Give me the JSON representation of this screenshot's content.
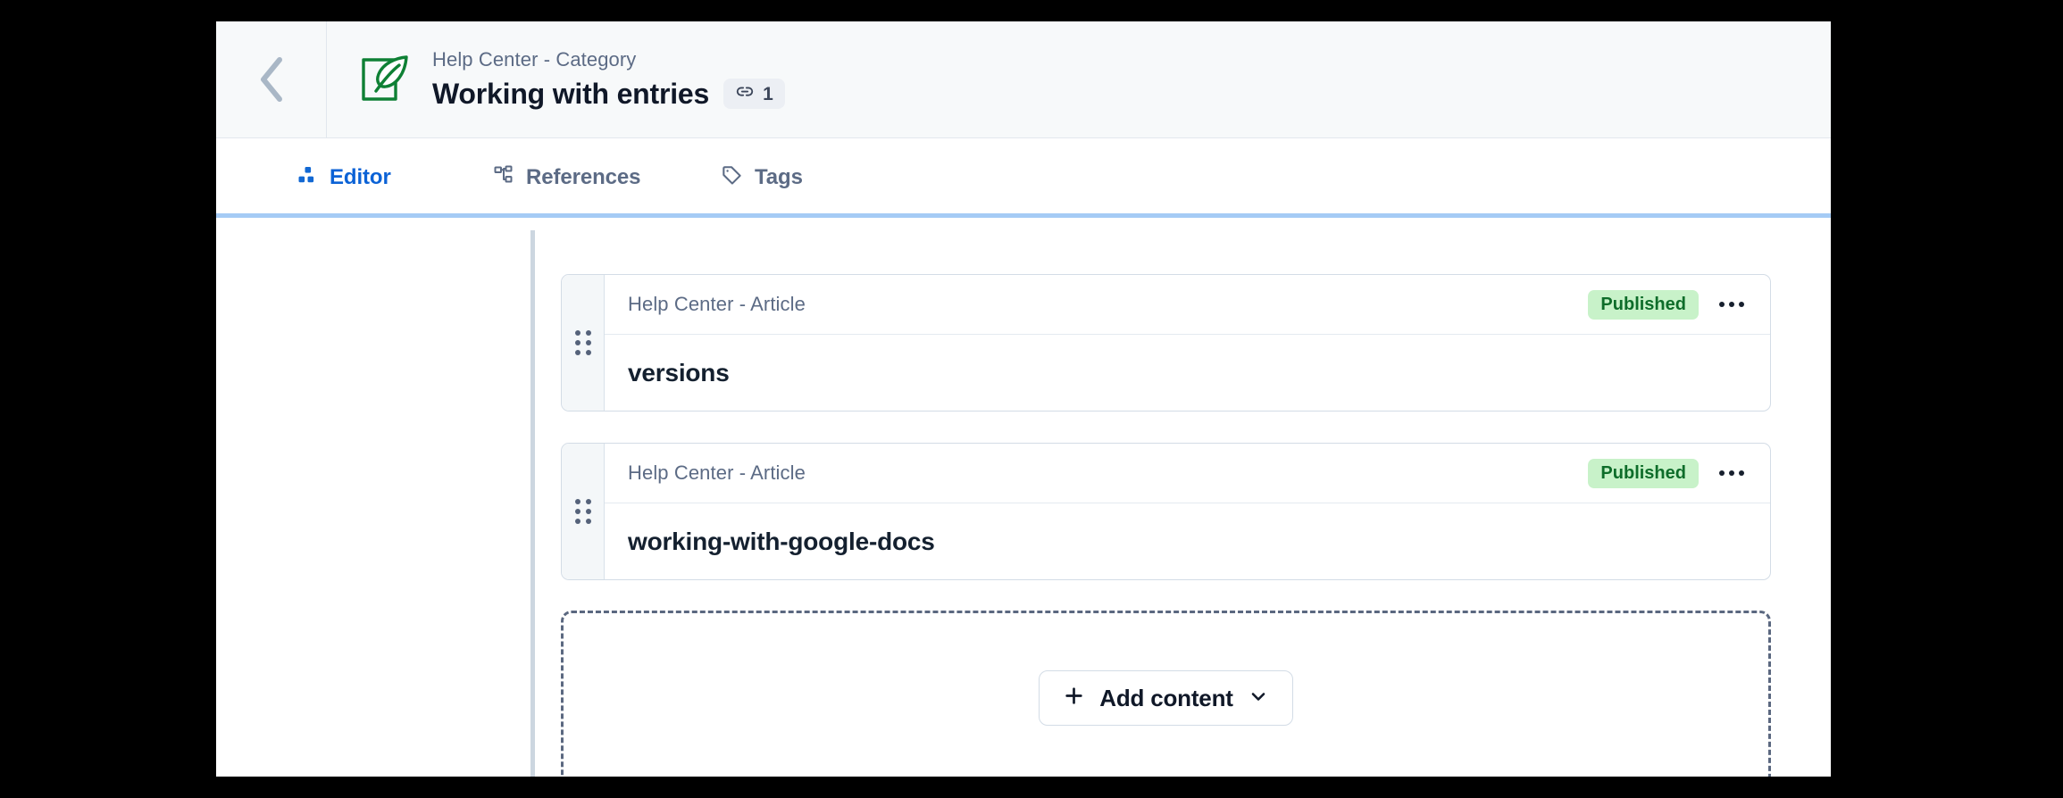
{
  "header": {
    "back_icon": "chevron-left-icon",
    "app_icon": "quill-note-icon",
    "content_type": "Help Center - Category",
    "title": "Working with entries",
    "links_chip": {
      "icon": "link-icon",
      "count": "1"
    }
  },
  "tabs": [
    {
      "id": "editor",
      "label": "Editor",
      "icon": "blocks-icon",
      "active": true
    },
    {
      "id": "references",
      "label": "References",
      "icon": "sitemap-icon",
      "active": false
    },
    {
      "id": "tags",
      "label": "Tags",
      "icon": "tag-icon",
      "active": false
    }
  ],
  "entries": [
    {
      "content_type": "Help Center - Article",
      "status": "Published",
      "title": "versions",
      "drag_handle_icon": "drag-dots-icon",
      "more_icon": "ellipsis-icon"
    },
    {
      "content_type": "Help Center - Article",
      "status": "Published",
      "title": "working-with-google-docs",
      "drag_handle_icon": "drag-dots-icon",
      "more_icon": "ellipsis-icon"
    }
  ],
  "add_content": {
    "label": "Add content",
    "plus_icon": "plus-icon",
    "chevron_icon": "chevron-down-icon"
  },
  "colors": {
    "accent": "#1268d3",
    "brand_green": "#0e8034",
    "status_published_bg": "#c8f2c9",
    "status_published_text": "#0e6d2a",
    "muted_text": "#5c6b85",
    "title_text": "#101828",
    "tab_rule": "#a5cbf5"
  }
}
